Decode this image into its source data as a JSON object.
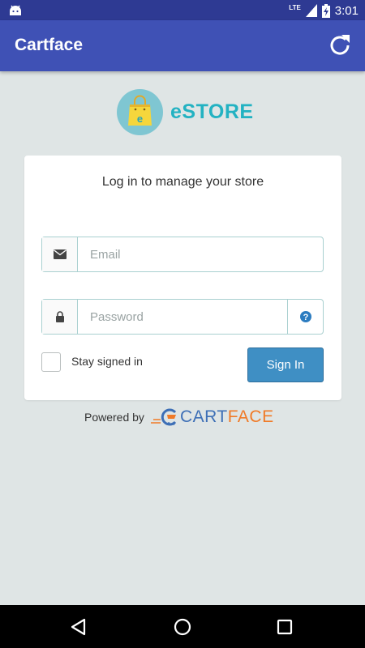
{
  "status_bar": {
    "time": "3:01",
    "network": "LTE",
    "icons": [
      "android-icon",
      "signal-icon",
      "battery-icon"
    ]
  },
  "app_bar": {
    "title": "Cartface",
    "action_icon": "refresh-icon"
  },
  "logo": {
    "text": "eSTORE",
    "badge_letter": "e",
    "colors": {
      "badge": "#7fc6d2",
      "bag": "#f5d63c",
      "text": "#23b2c2"
    }
  },
  "login_card": {
    "heading": "Log in to manage your store",
    "email": {
      "placeholder": "Email",
      "value": "",
      "icon": "envelope-icon"
    },
    "password": {
      "placeholder": "Password",
      "value": "",
      "icon": "lock-icon",
      "help_icon": "question-circle-icon"
    },
    "stay_signed_in": {
      "label": "Stay signed in",
      "checked": false
    },
    "sign_in_label": "Sign In"
  },
  "footer": {
    "powered_by": "Powered by",
    "brand_part1": "CART",
    "brand_part2": "FACE"
  },
  "nav_bar": {
    "buttons": [
      "back-icon",
      "home-icon",
      "recents-icon"
    ]
  },
  "colors": {
    "status_bar": "#2e3a93",
    "app_bar": "#3f51b5",
    "background": "#dfe5e5",
    "button": "#3f8fc4",
    "input_border": "#a9d0d0"
  }
}
